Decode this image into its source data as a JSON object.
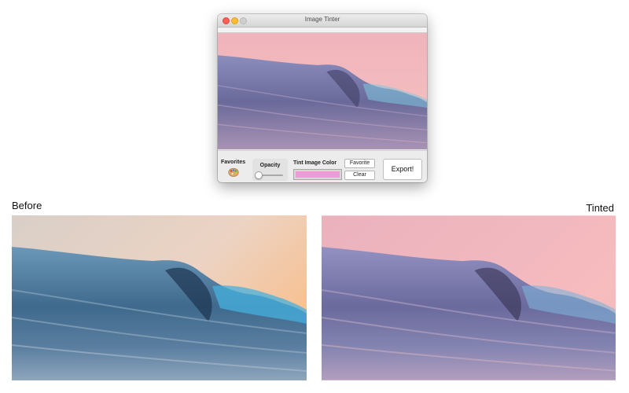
{
  "window": {
    "title": "Image Tinter",
    "controls": {
      "favorites_label": "Favorites",
      "favorites_icon": "palette-icon",
      "opacity_label": "Opacity",
      "opacity_value": 0,
      "tint_label": "Tint Image Color",
      "tint_color": "#f09ad8",
      "favorite_button": "Favorite",
      "clear_button": "Clear",
      "export_button": "Export!"
    }
  },
  "comparison": {
    "before_label": "Before",
    "tinted_label": "Tinted"
  },
  "colors": {
    "before_sky_top": "#e7d2c6",
    "before_sky_glow": "#f7c49a",
    "before_wave": "#3e6f95",
    "tinted_sky": "#f2b7bd",
    "tinted_wave": "#6e6c9c"
  }
}
